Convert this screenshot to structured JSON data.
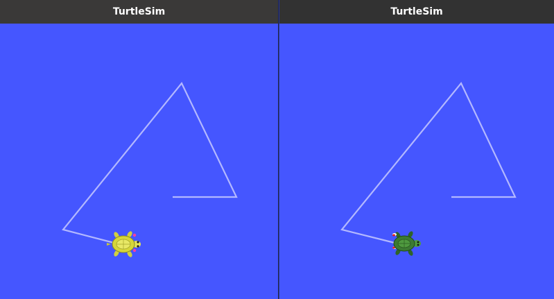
{
  "windows": [
    {
      "title": "TurtleSim",
      "background": "#4556ff",
      "pen_color": "#b3b8ff",
      "turtle": {
        "icon": "turtle-yellow-icon",
        "shell_color": "#d6d63a",
        "body_color": "#e3e35a"
      }
    },
    {
      "title": "TurtleSim",
      "background": "#4556ff",
      "pen_color": "#b3b8ff",
      "turtle": {
        "icon": "turtle-green-icon",
        "shell_color": "#3c7a32",
        "body_color": "#4f9a3f"
      }
    }
  ]
}
